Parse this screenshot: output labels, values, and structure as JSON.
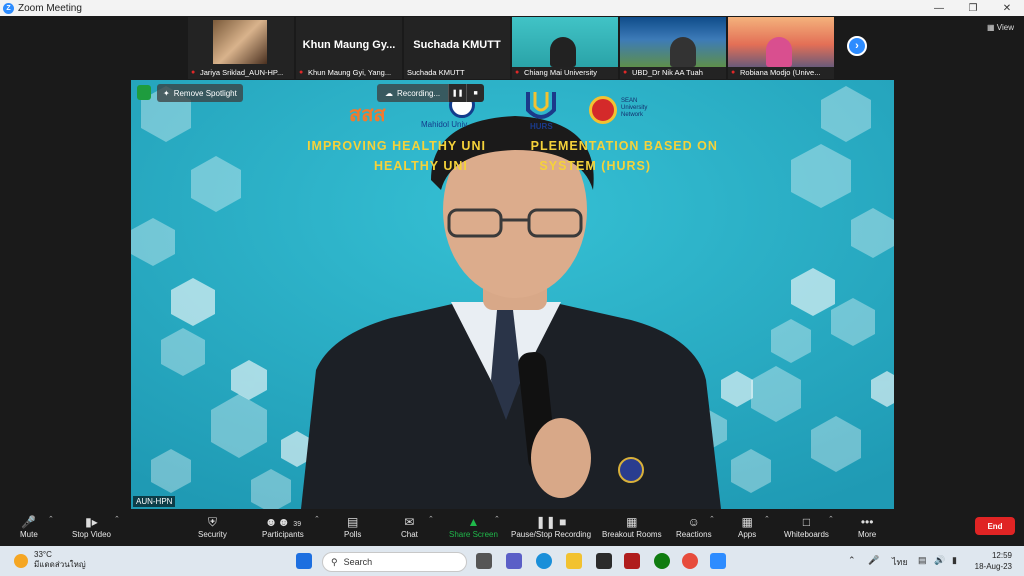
{
  "window": {
    "title": "Zoom Meeting"
  },
  "gallery": {
    "participants": [
      {
        "label": "Jariya Sriklad_AUN-HP..."
      },
      {
        "big_name": "Khun Maung Gy...",
        "label": "Khun Maung Gyi, Yang..."
      },
      {
        "big_name": "Suchada KMUTT",
        "label": "Suchada KMUTT"
      },
      {
        "label": "Chiang Mai University"
      },
      {
        "label": "UBD_Dr Nik AA Tuah"
      },
      {
        "label": "Robiana Modjo (Unive..."
      }
    ],
    "view_label": "View"
  },
  "spotlight": {
    "remove_label": "Remove Spotlight",
    "recording_label": "Recording...",
    "speaker_label": "AUN-HPN",
    "slide_title_1": "IMPROVING HEALTHY UNI          PLEMENTATION BASED ON",
    "slide_title_2": "HEALTHY UNI                SYSTEM (HURS)",
    "logo_thai": "สสส",
    "logo_mahidol": "Mahidol Univ",
    "logo_hurs": "HURS",
    "logo_asean": "SEAN University Network"
  },
  "toolbar": {
    "mute": "Mute",
    "stop_video": "Stop Video",
    "security": "Security",
    "participants": "Participants",
    "participants_count": "39",
    "polls": "Polls",
    "chat": "Chat",
    "share_screen": "Share Screen",
    "pause_recording": "Pause/Stop Recording",
    "breakout": "Breakout Rooms",
    "reactions": "Reactions",
    "apps": "Apps",
    "whiteboards": "Whiteboards",
    "more": "More",
    "end": "End"
  },
  "taskbar": {
    "temp": "33°C",
    "weather_desc": "มีแดดส่วนใหญ่",
    "search_placeholder": "Search",
    "lang": "ไทย",
    "time": "12:59",
    "date": "18-Aug-23"
  },
  "colors": {
    "accent": "#2d8cff",
    "end": "#e02424",
    "share": "#1fb84a",
    "slide_bg": "#2bb2c8",
    "slide_title": "#f5d23a"
  }
}
